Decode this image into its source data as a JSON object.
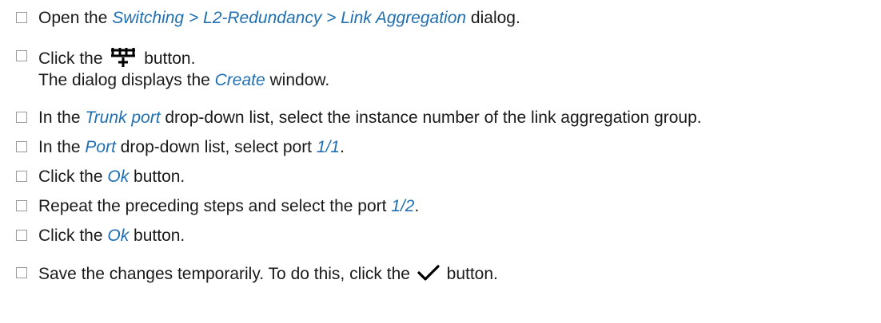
{
  "steps": [
    {
      "pre": "Open the ",
      "ref": "Switching > L2-Redundancy > Link Aggregation",
      "post": " dialog."
    },
    {
      "pre": "Click the ",
      "icon": "add-link-aggregation-icon",
      "post": " button.",
      "note_pre": "The dialog displays the ",
      "note_ref": "Create",
      "note_post": " window."
    },
    {
      "pre": "In the ",
      "ref": "Trunk port",
      "post": " drop-down list, select the instance number of the link aggregation group."
    },
    {
      "pre": "In the ",
      "ref": "Port",
      "mid": " drop-down list, select port ",
      "ref2": "1/1",
      "post": "."
    },
    {
      "pre": "Click the ",
      "ref": "Ok",
      "post": " button."
    },
    {
      "pre": "Repeat the preceding steps and select the port ",
      "ref": "1/2",
      "post": "."
    },
    {
      "pre": "Click the ",
      "ref": "Ok",
      "post": " button."
    },
    {
      "pre": "Save the changes temporarily. To do this, click the ",
      "icon": "checkmark-icon",
      "post": " button."
    }
  ],
  "colors": {
    "reference": "#1f6fb2",
    "text": "#1a1a1a",
    "checkbox_border": "#9a9a9a"
  }
}
